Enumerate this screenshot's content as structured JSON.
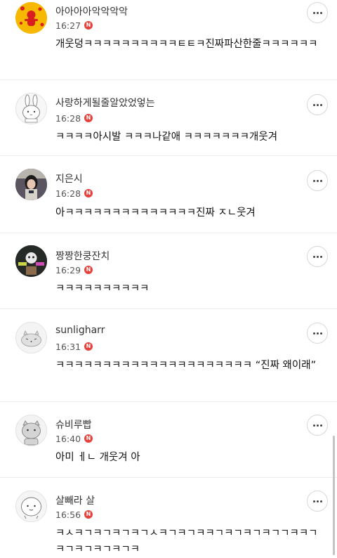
{
  "comments": [
    {
      "nickname": "아아아아악악악악",
      "time": "16:27",
      "badge": "N",
      "text": "개웃덩ㅋㅋㅋㅋㅋㅋㅋㅋㅋㅋㅌㅌㅋ진짜파산한줄ㅋㅋㅋㅋㅋㅋ"
    },
    {
      "nickname": "사랑하게될줄알았었엏는",
      "time": "16:28",
      "badge": "N",
      "text": "ㅋㅋㅋㅋ아시발 ㅋㅋㅋ나같애 ㅋㅋㅋㅋㅋㅋㅋ개웃겨"
    },
    {
      "nickname": "지은시",
      "time": "16:28",
      "badge": "N",
      "text": "아ㅋㅋㅋㅋㅋㅋㅋㅋㅋㅋㅋㅋㅋㅋ진짜 ㅈㄴ웃겨"
    },
    {
      "nickname": "짱짱한쿵잔치",
      "time": "16:29",
      "badge": "N",
      "text": "ㅋㅋㅋㅋㅋㅋㅋㅋㅋㅋ"
    },
    {
      "nickname": "sunligharr",
      "time": "16:31",
      "badge": "N",
      "text": "ㅋㅋㅋㅋㅋㅋㅋㅋㅋㅋㅋㅋㅋㅋㅋㅋㅋㅋㅋㅋㅋ “진짜 왜이래”"
    },
    {
      "nickname": "슈비루빱",
      "time": "16:40",
      "badge": "N",
      "text": "아미 ㅔㄴ 개웃겨 아"
    },
    {
      "nickname": "살빼라 살",
      "time": "16:56",
      "badge": "N",
      "text": "ㅋㅅㅋㄱㅋㄱㅋㄱㅋㄱㅅㅋㄱㅋㄱㅋㅋㄱㅋㄱㅋㄱㅋㄱㄱㅋㅋㄱㅋㄱㅋㄱㅋㄱㅋㄱㅋ"
    }
  ],
  "icons": {
    "more": "more-horizontal-icon",
    "badge": "new-badge"
  },
  "colors": {
    "badge": "#e8403c",
    "divider": "#ececec"
  }
}
